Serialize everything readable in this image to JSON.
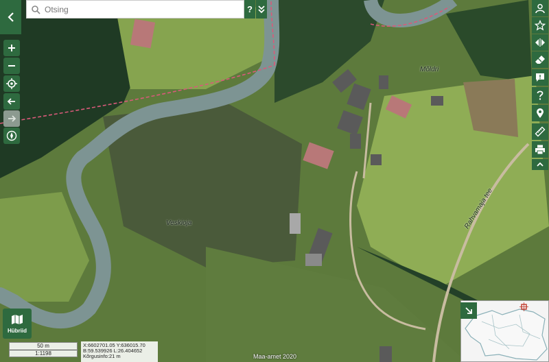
{
  "search": {
    "placeholder": "Otsing",
    "help_label": "?"
  },
  "layer_button": {
    "label": "Hübriid"
  },
  "scale": {
    "bar_label": "50 m",
    "ratio": "1:1198"
  },
  "coords": {
    "line1": "X:6602701.05 Y:636015.70",
    "line2": "B:59.539926 L:26.404652",
    "line3": "Kõrgusinfo:21 m"
  },
  "attribution": "Maa-amet 2020",
  "map_labels": {
    "village": "Mõldri",
    "stream": "Veskioja",
    "road": "Rahvamaja tee"
  },
  "icons": {
    "left_toolbar": [
      "zoom-in-icon",
      "zoom-out-icon",
      "locate-icon",
      "back-arrow-icon",
      "forward-arrow-icon",
      "compass-icon"
    ],
    "right_toolbar": [
      "user-icon",
      "star-icon",
      "compare-icon",
      "eraser-icon",
      "feedback-icon",
      "help-icon",
      "pin-icon",
      "ruler-icon",
      "print-icon",
      "chevron-up-icon"
    ]
  },
  "colors": {
    "ui_green": "#2e6a3f",
    "river": "#7d9493",
    "trail": "#d95a7a"
  }
}
